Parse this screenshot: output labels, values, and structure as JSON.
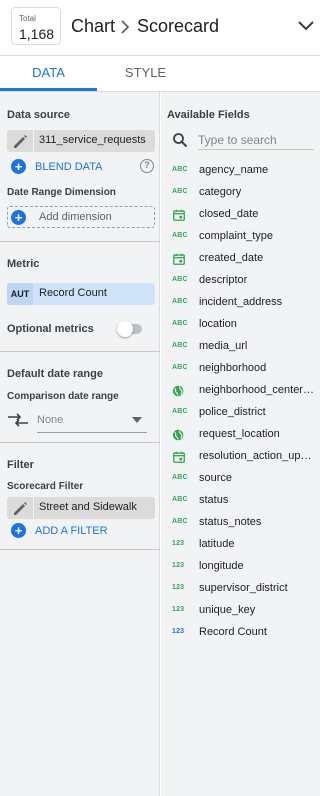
{
  "header": {
    "total_label": "Total",
    "total_value": "1,168",
    "breadcrumb_root": "Chart",
    "breadcrumb_current": "Scorecard"
  },
  "tabs": [
    {
      "label": "DATA",
      "active": true
    },
    {
      "label": "STYLE",
      "active": false
    }
  ],
  "data_panel": {
    "data_source_title": "Data source",
    "data_source_name": "311_service_requests",
    "blend_label": "BLEND DATA",
    "help_symbol": "?",
    "date_range_dimension_title": "Date Range Dimension",
    "add_dimension_label": "Add dimension",
    "metric_title": "Metric",
    "metric_type_badge": "AUT",
    "metric_name": "Record Count",
    "optional_metrics_label": "Optional metrics",
    "optional_metrics_enabled": false,
    "default_date_range_title": "Default date range",
    "comparison_label": "Comparison date range",
    "comparison_value": "None",
    "filter_title": "Filter",
    "scorecard_filter_label": "Scorecard Filter",
    "scorecard_filter_value": "Street and Sidewalk",
    "add_filter_label": "ADD A FILTER"
  },
  "available_fields": {
    "title": "Available Fields",
    "search_placeholder": "Type to search",
    "fields": [
      {
        "type": "text",
        "badge": "ABC",
        "name": "agency_name"
      },
      {
        "type": "text",
        "badge": "ABC",
        "name": "category"
      },
      {
        "type": "date",
        "badge": "",
        "name": "closed_date"
      },
      {
        "type": "text",
        "badge": "ABC",
        "name": "complaint_type"
      },
      {
        "type": "date",
        "badge": "",
        "name": "created_date"
      },
      {
        "type": "text",
        "badge": "ABC",
        "name": "descriptor"
      },
      {
        "type": "text",
        "badge": "ABC",
        "name": "incident_address"
      },
      {
        "type": "text",
        "badge": "ABC",
        "name": "location"
      },
      {
        "type": "text",
        "badge": "ABC",
        "name": "media_url"
      },
      {
        "type": "text",
        "badge": "ABC",
        "name": "neighborhood"
      },
      {
        "type": "geo",
        "badge": "",
        "name": "neighborhood_center_point"
      },
      {
        "type": "text",
        "badge": "ABC",
        "name": "police_district"
      },
      {
        "type": "geo",
        "badge": "",
        "name": "request_location"
      },
      {
        "type": "date",
        "badge": "",
        "name": "resolution_action_updated_date"
      },
      {
        "type": "text",
        "badge": "ABC",
        "name": "source"
      },
      {
        "type": "text",
        "badge": "ABC",
        "name": "status"
      },
      {
        "type": "text",
        "badge": "ABC",
        "name": "status_notes"
      },
      {
        "type": "number",
        "badge": "123",
        "name": "latitude"
      },
      {
        "type": "number",
        "badge": "123",
        "name": "longitude"
      },
      {
        "type": "number",
        "badge": "123",
        "name": "supervisor_district"
      },
      {
        "type": "number",
        "badge": "123",
        "name": "unique_key"
      },
      {
        "type": "metric",
        "badge": "123",
        "name": "Record Count"
      }
    ]
  },
  "colors": {
    "accent": "#1a73e8",
    "dimension_green": "#34a853",
    "panel_bg": "#f1f3f4"
  }
}
